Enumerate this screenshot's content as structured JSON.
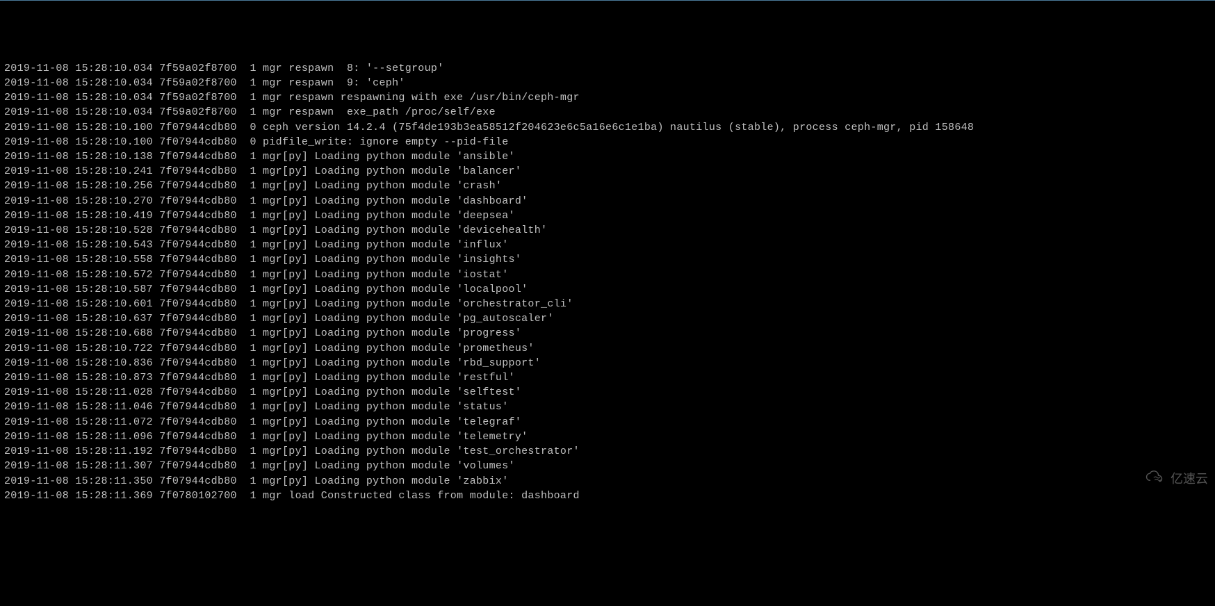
{
  "logs": [
    {
      "ts": "2019-11-08 15:28:10.034",
      "thread": "7f59a02f8700",
      "lvl": " 1",
      "comp": "mgr respawn  8: '--setgroup'"
    },
    {
      "ts": "2019-11-08 15:28:10.034",
      "thread": "7f59a02f8700",
      "lvl": " 1",
      "comp": "mgr respawn  9: 'ceph'"
    },
    {
      "ts": "2019-11-08 15:28:10.034",
      "thread": "7f59a02f8700",
      "lvl": " 1",
      "comp": "mgr respawn respawning with exe /usr/bin/ceph-mgr"
    },
    {
      "ts": "2019-11-08 15:28:10.034",
      "thread": "7f59a02f8700",
      "lvl": " 1",
      "comp": "mgr respawn  exe_path /proc/self/exe"
    },
    {
      "ts": "2019-11-08 15:28:10.100",
      "thread": "7f07944cdb80",
      "lvl": " 0",
      "comp": "ceph version 14.2.4 (75f4de193b3ea58512f204623e6c5a16e6c1e1ba) nautilus (stable), process ceph-mgr, pid 158648"
    },
    {
      "ts": "2019-11-08 15:28:10.100",
      "thread": "7f07944cdb80",
      "lvl": " 0",
      "comp": "pidfile_write: ignore empty --pid-file"
    },
    {
      "ts": "2019-11-08 15:28:10.138",
      "thread": "7f07944cdb80",
      "lvl": " 1",
      "comp": "mgr[py] Loading python module 'ansible'"
    },
    {
      "ts": "2019-11-08 15:28:10.241",
      "thread": "7f07944cdb80",
      "lvl": " 1",
      "comp": "mgr[py] Loading python module 'balancer'"
    },
    {
      "ts": "2019-11-08 15:28:10.256",
      "thread": "7f07944cdb80",
      "lvl": " 1",
      "comp": "mgr[py] Loading python module 'crash'"
    },
    {
      "ts": "2019-11-08 15:28:10.270",
      "thread": "7f07944cdb80",
      "lvl": " 1",
      "comp": "mgr[py] Loading python module 'dashboard'"
    },
    {
      "ts": "2019-11-08 15:28:10.419",
      "thread": "7f07944cdb80",
      "lvl": " 1",
      "comp": "mgr[py] Loading python module 'deepsea'"
    },
    {
      "ts": "2019-11-08 15:28:10.528",
      "thread": "7f07944cdb80",
      "lvl": " 1",
      "comp": "mgr[py] Loading python module 'devicehealth'"
    },
    {
      "ts": "2019-11-08 15:28:10.543",
      "thread": "7f07944cdb80",
      "lvl": " 1",
      "comp": "mgr[py] Loading python module 'influx'"
    },
    {
      "ts": "2019-11-08 15:28:10.558",
      "thread": "7f07944cdb80",
      "lvl": " 1",
      "comp": "mgr[py] Loading python module 'insights'"
    },
    {
      "ts": "2019-11-08 15:28:10.572",
      "thread": "7f07944cdb80",
      "lvl": " 1",
      "comp": "mgr[py] Loading python module 'iostat'"
    },
    {
      "ts": "2019-11-08 15:28:10.587",
      "thread": "7f07944cdb80",
      "lvl": " 1",
      "comp": "mgr[py] Loading python module 'localpool'"
    },
    {
      "ts": "2019-11-08 15:28:10.601",
      "thread": "7f07944cdb80",
      "lvl": " 1",
      "comp": "mgr[py] Loading python module 'orchestrator_cli'"
    },
    {
      "ts": "2019-11-08 15:28:10.637",
      "thread": "7f07944cdb80",
      "lvl": " 1",
      "comp": "mgr[py] Loading python module 'pg_autoscaler'"
    },
    {
      "ts": "2019-11-08 15:28:10.688",
      "thread": "7f07944cdb80",
      "lvl": " 1",
      "comp": "mgr[py] Loading python module 'progress'"
    },
    {
      "ts": "2019-11-08 15:28:10.722",
      "thread": "7f07944cdb80",
      "lvl": " 1",
      "comp": "mgr[py] Loading python module 'prometheus'"
    },
    {
      "ts": "2019-11-08 15:28:10.836",
      "thread": "7f07944cdb80",
      "lvl": " 1",
      "comp": "mgr[py] Loading python module 'rbd_support'"
    },
    {
      "ts": "2019-11-08 15:28:10.873",
      "thread": "7f07944cdb80",
      "lvl": " 1",
      "comp": "mgr[py] Loading python module 'restful'"
    },
    {
      "ts": "2019-11-08 15:28:11.028",
      "thread": "7f07944cdb80",
      "lvl": " 1",
      "comp": "mgr[py] Loading python module 'selftest'"
    },
    {
      "ts": "2019-11-08 15:28:11.046",
      "thread": "7f07944cdb80",
      "lvl": " 1",
      "comp": "mgr[py] Loading python module 'status'"
    },
    {
      "ts": "2019-11-08 15:28:11.072",
      "thread": "7f07944cdb80",
      "lvl": " 1",
      "comp": "mgr[py] Loading python module 'telegraf'"
    },
    {
      "ts": "2019-11-08 15:28:11.096",
      "thread": "7f07944cdb80",
      "lvl": " 1",
      "comp": "mgr[py] Loading python module 'telemetry'"
    },
    {
      "ts": "2019-11-08 15:28:11.192",
      "thread": "7f07944cdb80",
      "lvl": " 1",
      "comp": "mgr[py] Loading python module 'test_orchestrator'"
    },
    {
      "ts": "2019-11-08 15:28:11.307",
      "thread": "7f07944cdb80",
      "lvl": " 1",
      "comp": "mgr[py] Loading python module 'volumes'"
    },
    {
      "ts": "2019-11-08 15:28:11.350",
      "thread": "7f07944cdb80",
      "lvl": " 1",
      "comp": "mgr[py] Loading python module 'zabbix'"
    },
    {
      "ts": "2019-11-08 15:28:11.369",
      "thread": "7f0780102700",
      "lvl": " 1",
      "comp": "mgr load Constructed class from module: dashboard"
    }
  ],
  "watermark": {
    "text": "亿速云"
  }
}
